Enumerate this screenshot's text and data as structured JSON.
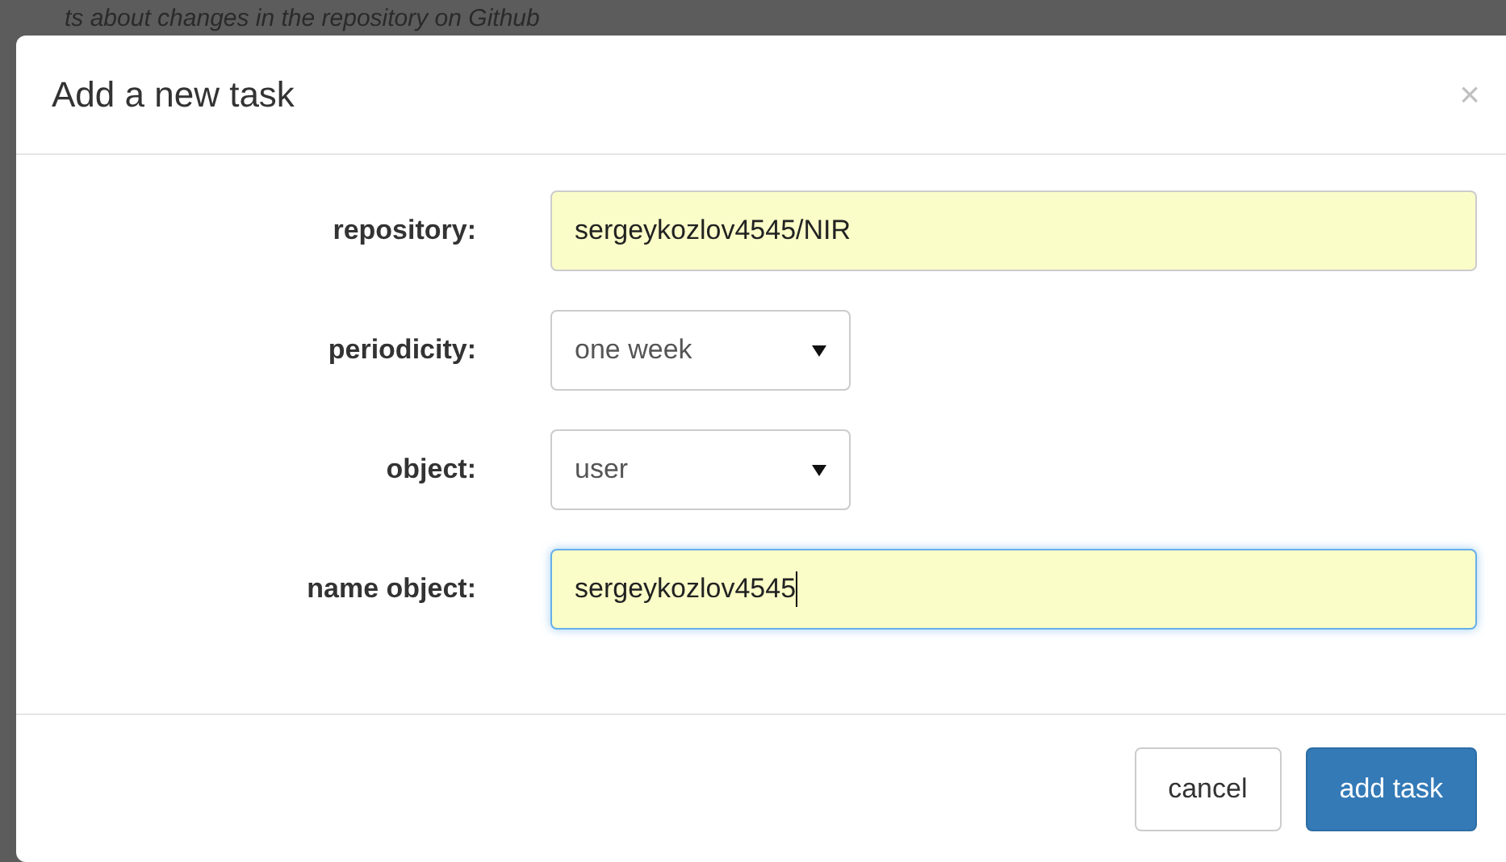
{
  "background_text": "ts about changes in the repository on Github",
  "dialog": {
    "title": "Add a new task",
    "close": "×",
    "fields": [
      {
        "kind": "text",
        "label": "repository:",
        "value": "sergeykozlov4545/NIR",
        "focused": false
      },
      {
        "kind": "select",
        "label": "periodicity:",
        "value": "one week",
        "focused": false
      },
      {
        "kind": "select",
        "label": "object:",
        "value": "user",
        "focused": false
      },
      {
        "kind": "text",
        "label": "name object:",
        "value": "sergeykozlov4545",
        "focused": true
      }
    ],
    "buttons": [
      {
        "label": "cancel",
        "kind": "default"
      },
      {
        "label": "add task",
        "kind": "primary"
      }
    ]
  }
}
